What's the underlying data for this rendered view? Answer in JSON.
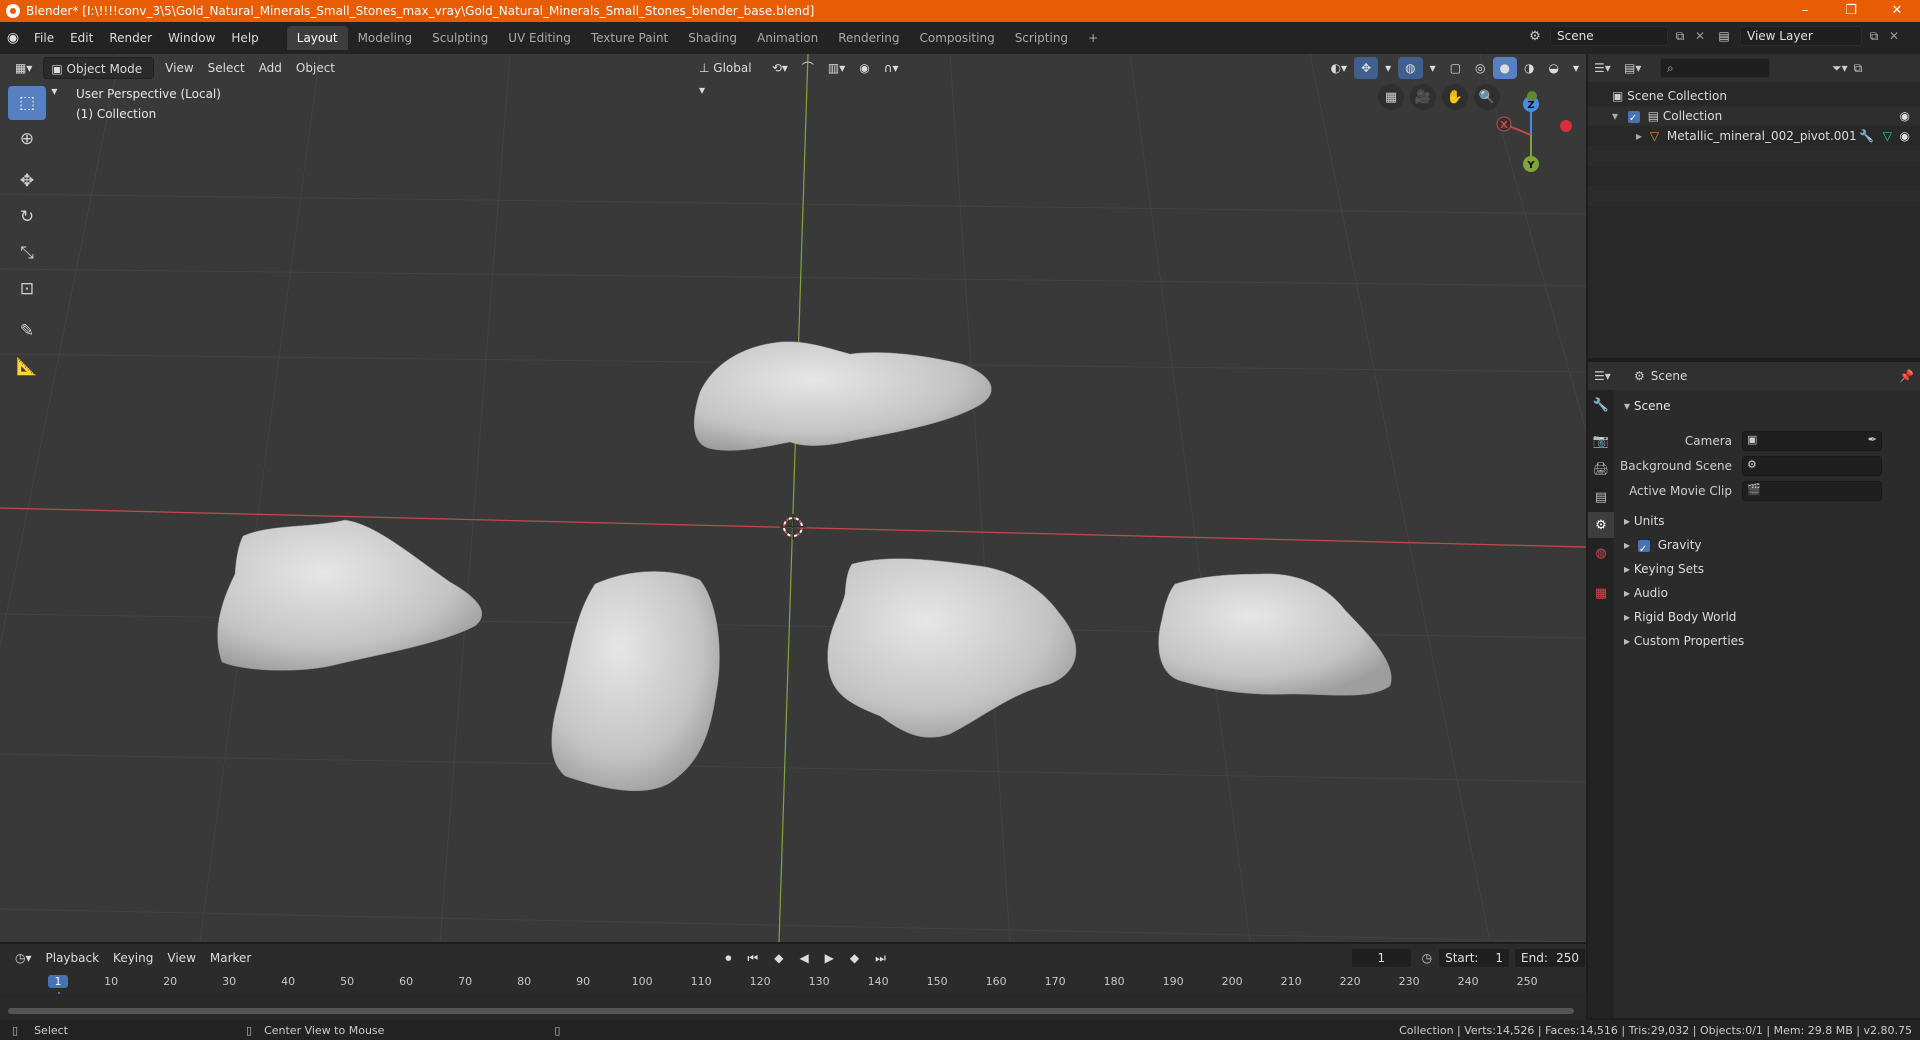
{
  "window": {
    "title": "Blender* [I:\\!!!!conv_3\\5\\Gold_Natural_Minerals_Small_Stones_max_vray\\Gold_Natural_Minerals_Small_Stones_blender_base.blend]",
    "controls": [
      "–",
      "❐",
      "✕"
    ]
  },
  "menu": {
    "items": [
      "File",
      "Edit",
      "Render",
      "Window",
      "Help"
    ]
  },
  "workspaces": {
    "tabs": [
      "Layout",
      "Modeling",
      "Sculpting",
      "UV Editing",
      "Texture Paint",
      "Shading",
      "Animation",
      "Rendering",
      "Compositing",
      "Scripting"
    ],
    "active": "Layout",
    "add": "+"
  },
  "scene_selector": {
    "value": "Scene"
  },
  "view_layer_selector": {
    "value": "View Layer"
  },
  "viewport": {
    "mode": "Object Mode",
    "menus": [
      "View",
      "Select",
      "Add",
      "Object"
    ],
    "transform_orientation": "Global",
    "info_line1": "User Perspective (Local)",
    "info_line2": "(1) Collection",
    "gizmo_labels": {
      "x": "X",
      "y": "Y",
      "z": "Z"
    },
    "tools": [
      "select-box",
      "cursor",
      "move",
      "rotate",
      "scale",
      "transform",
      "annotate",
      "measure"
    ],
    "colors": {
      "background": "#393939",
      "x_axis": "#c44a4a",
      "y_axis": "#7fa63a",
      "object": "#c8c8c8"
    }
  },
  "outliner": {
    "root": "Scene Collection",
    "collection": "Collection",
    "object": "Metallic_mineral_002_pivot.001"
  },
  "properties": {
    "header": "Scene",
    "panel_title": "Scene",
    "camera_label": "Camera",
    "background_scene_label": "Background Scene",
    "active_movie_clip_label": "Active Movie Clip",
    "subpanels": [
      "Units",
      "Gravity",
      "Keying Sets",
      "Audio",
      "Rigid Body World",
      "Custom Properties"
    ]
  },
  "timeline": {
    "menus": [
      "Playback",
      "Keying",
      "View",
      "Marker"
    ],
    "current_frame": "1",
    "start_label": "Start:",
    "start_value": "1",
    "end_label": "End:",
    "end_value": "250",
    "ruler_ticks": [
      "1",
      "10",
      "20",
      "30",
      "40",
      "50",
      "60",
      "70",
      "80",
      "90",
      "100",
      "110",
      "120",
      "130",
      "140",
      "150",
      "160",
      "170",
      "180",
      "190",
      "200",
      "210",
      "220",
      "230",
      "240",
      "250"
    ]
  },
  "statusbar": {
    "left_action": "Select",
    "middle_action": "Center View to Mouse",
    "stats": "Collection | Verts:14,526 | Faces:14,516 | Tris:29,032 | Objects:0/1 | Mem: 29.8 MB | v2.80.75"
  }
}
